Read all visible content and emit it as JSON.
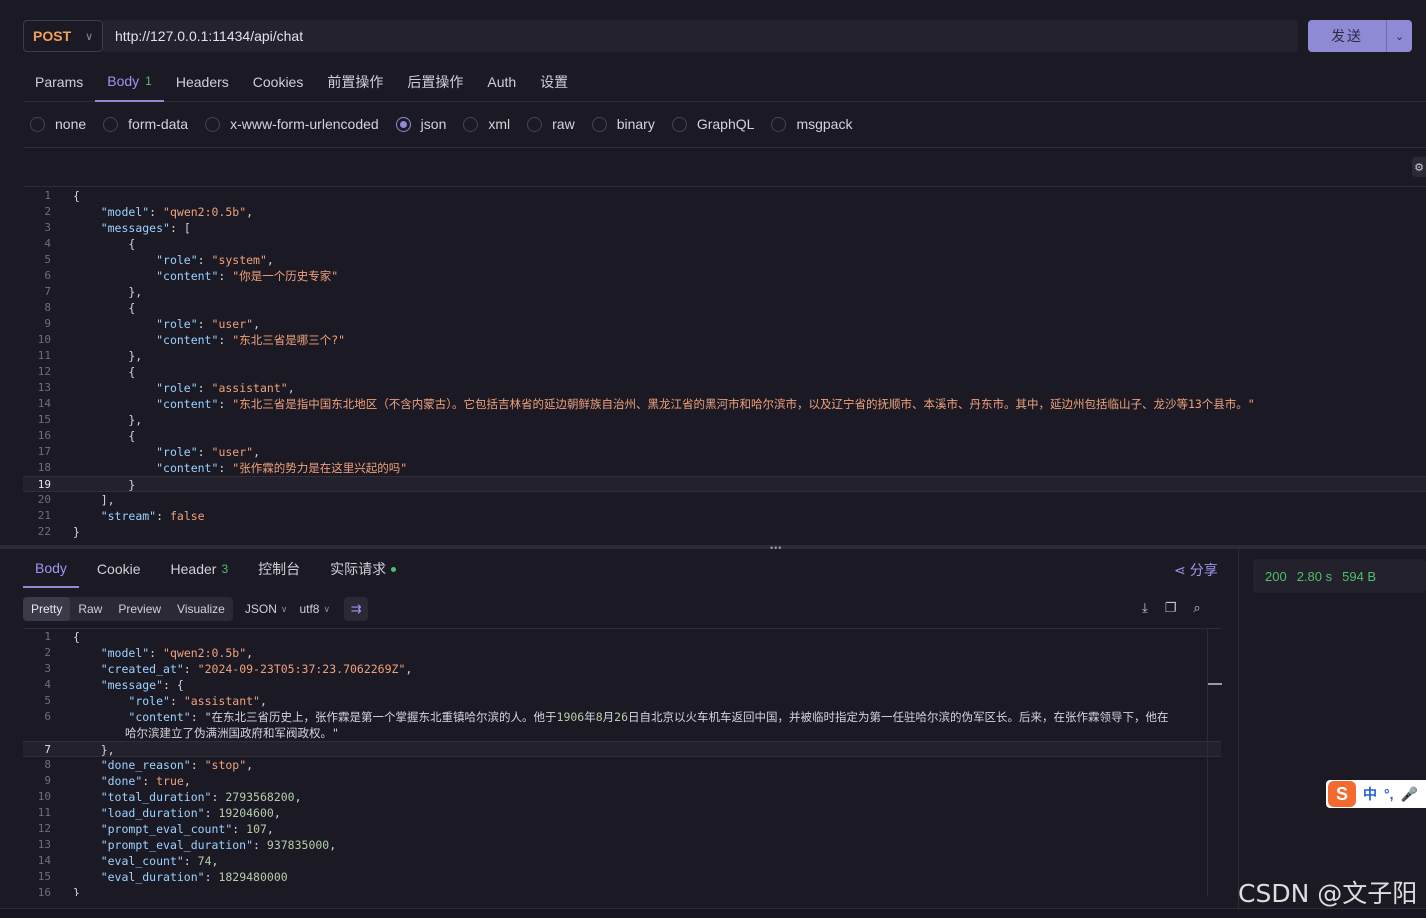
{
  "request": {
    "method": "POST",
    "url": "http://127.0.0.1:11434/api/chat",
    "send_label": "发送"
  },
  "req_tabs": [
    {
      "label": "Params"
    },
    {
      "label": "Body",
      "count": "1"
    },
    {
      "label": "Headers"
    },
    {
      "label": "Cookies"
    },
    {
      "label": "前置操作"
    },
    {
      "label": "后置操作"
    },
    {
      "label": "Auth"
    },
    {
      "label": "设置"
    }
  ],
  "body_types": [
    "none",
    "form-data",
    "x-www-form-urlencoded",
    "json",
    "xml",
    "raw",
    "binary",
    "GraphQL",
    "msgpack"
  ],
  "body_type_selected": "json",
  "request_body_lines": [
    "{",
    "    \"model\": \"qwen2:0.5b\",",
    "    \"messages\": [",
    "        {",
    "            \"role\": \"system\",",
    "            \"content\": \"你是一个历史专家\"",
    "        },",
    "        {",
    "            \"role\": \"user\",",
    "            \"content\": \"东北三省是哪三个?\"",
    "        },",
    "        {",
    "            \"role\": \"assistant\",",
    "            \"content\": \"东北三省是指中国东北地区（不含内蒙古）。它包括吉林省的延边朝鲜族自治州、黑龙江省的黑河市和哈尔滨市，以及辽宁省的抚顺市、本溪市、丹东市。其中，延边州包括临山子、龙沙等13个县市。\"",
    "        },",
    "        {",
    "            \"role\": \"user\",",
    "            \"content\": \"张作霖的势力是在这里兴起的吗\"",
    "        }",
    "    ],",
    "    \"stream\": false",
    "}"
  ],
  "request_cursor_line": 19,
  "resp_tabs": [
    {
      "label": "Body"
    },
    {
      "label": "Cookie"
    },
    {
      "label": "Header",
      "count": "3"
    },
    {
      "label": "控制台"
    },
    {
      "label": "实际请求"
    }
  ],
  "share_label": "分享",
  "status": {
    "code": "200",
    "time": "2.80 s",
    "size": "594 B"
  },
  "view_modes": [
    "Pretty",
    "Raw",
    "Preview",
    "Visualize"
  ],
  "view_format": "JSON",
  "view_encoding": "utf8",
  "response_lines": [
    "{",
    "    \"model\": \"qwen2:0.5b\",",
    "    \"created_at\": \"2024-09-23T05:37:23.7062269Z\",",
    "    \"message\": {",
    "        \"role\": \"assistant\",",
    "        \"content\": \"在东北三省历史上，张作霖是第一个掌握东北重镇哈尔滨的人。他于1906年8月26日自北京以火车机车返回中国，并被临时指定为第一任驻哈尔滨的伪军区长。后来，在张作霖领导下，他在",
    "哈尔滨建立了伪满洲国政府和军阀政权。\"",
    "    },",
    "    \"done_reason\": \"stop\",",
    "    \"done\": true,",
    "    \"total_duration\": 2793568200,",
    "    \"load_duration\": 19204600,",
    "    \"prompt_eval_count\": 107,",
    "    \"prompt_eval_duration\": 937835000,",
    "    \"eval_count\": 74,",
    "    \"eval_duration\": 1829480000",
    "}"
  ],
  "response_line_numbers": [
    "1",
    "2",
    "3",
    "4",
    "5",
    "6",
    "",
    "7",
    "8",
    "9",
    "10",
    "11",
    "12",
    "13",
    "14",
    "15",
    "16"
  ],
  "response_cursor_line": 7,
  "ime": {
    "lang": "中",
    "punct": "°,"
  },
  "watermark": "CSDN @文子阳"
}
